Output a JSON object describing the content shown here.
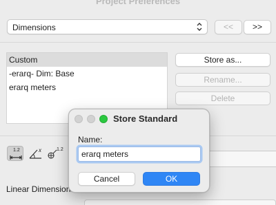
{
  "window": {
    "title": "Project Preferences"
  },
  "toolbar": {
    "section_popup": "Dimensions",
    "prev_button": "<<",
    "next_button": ">>"
  },
  "standards": {
    "items": [
      {
        "label": "Custom",
        "selected": true
      },
      {
        "label": "-erarq- Dim: Base",
        "selected": false
      },
      {
        "label": "erarq meters",
        "selected": false
      }
    ],
    "store_as_button": "Store as...",
    "rename_button": "Rename...",
    "delete_button": "Delete"
  },
  "tools": {
    "tool1_text": "1.2",
    "tool2_text": "x",
    "tool3_text": "1.2"
  },
  "linear": {
    "label": "Linear Dimensions"
  },
  "dialog": {
    "title": "Store Standard",
    "name_label": "Name:",
    "name_value": "erarq meters",
    "cancel_button": "Cancel",
    "ok_button": "OK"
  },
  "colors": {
    "accent": "#2f86f5",
    "focus_ring": "#a9c9f2",
    "close_green": "#2bc840"
  }
}
